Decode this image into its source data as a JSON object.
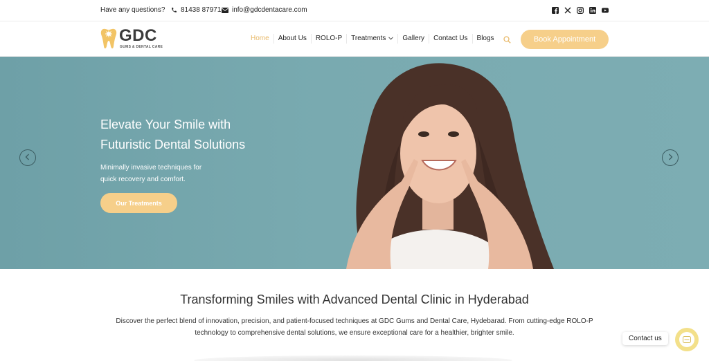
{
  "topbar": {
    "question": "Have any questions?",
    "phone": "81438 87971",
    "email": "info@gdcdentacare.com",
    "social_icons": [
      "facebook-icon",
      "x-icon",
      "instagram-icon",
      "linkedin-icon",
      "youtube-icon"
    ]
  },
  "logo": {
    "wordmark": "GDC",
    "tagline": "GUMS & DENTAL CARE"
  },
  "nav": {
    "items": [
      {
        "label": "Home",
        "active": true
      },
      {
        "label": "About Us"
      },
      {
        "label": "ROLO-P"
      },
      {
        "label": "Treatments",
        "dropdown": true
      },
      {
        "label": "Gallery"
      },
      {
        "label": "Contact Us"
      },
      {
        "label": "Blogs"
      }
    ],
    "book_label": "Book Appointment"
  },
  "hero": {
    "title_line1": "Elevate Your Smile with",
    "title_line2": "Futuristic Dental Solutions",
    "subtitle_line1": "Minimally invasive techniques for",
    "subtitle_line2": "quick recovery and comfort.",
    "button_label": "Our Treatments"
  },
  "intro": {
    "title": "Transforming Smiles with Advanced Dental Clinic in Hyderabad",
    "text": "Discover the perfect blend of innovation, precision, and patient-focused techniques at GDC Gums and Dental Care, Hydebarad. From cutting-edge ROLO-P technology to comprehensive dental solutions, we ensure exceptional care for a healthier, brighter smile."
  },
  "widget": {
    "contact_label": "Contact us"
  },
  "colors": {
    "accent": "#f6cf8a",
    "active_nav": "#e8b96a",
    "hero_bg": "#79aab0"
  }
}
